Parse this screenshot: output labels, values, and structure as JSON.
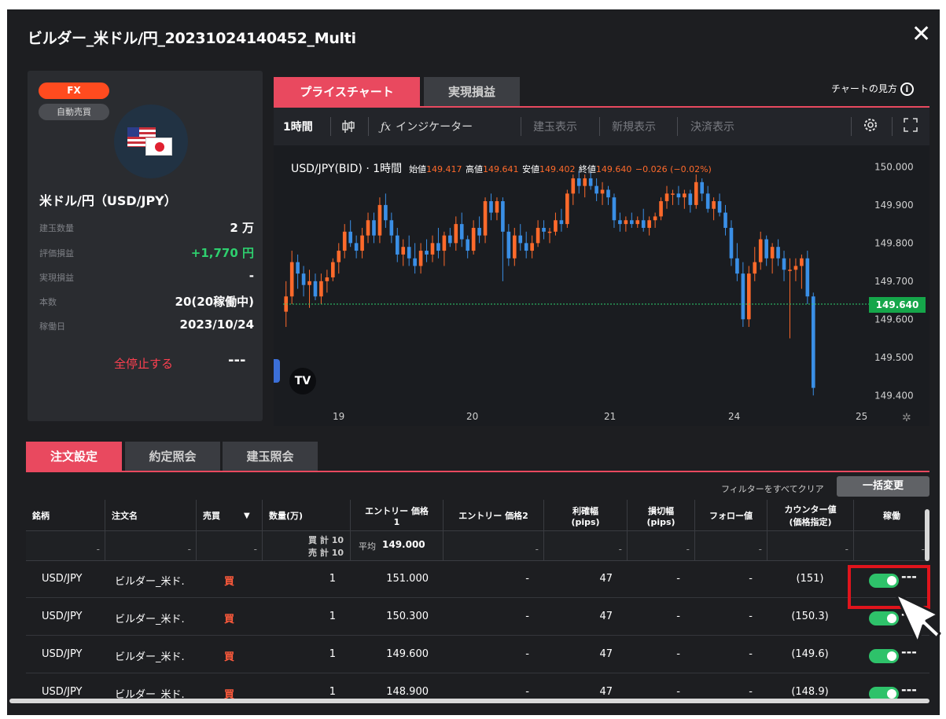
{
  "window": {
    "title": "ビルダー_米ドル/円_20231024140452_Multi",
    "close": "✕"
  },
  "info": {
    "badge_fx": "FX",
    "badge_auto": "自動売買",
    "pair": "米ドル/円（USD/JPY）",
    "rows": [
      {
        "label": "建玉数量",
        "value": "2 万"
      },
      {
        "label": "評価損益",
        "value": "+1,770 円"
      },
      {
        "label": "実現損益",
        "value": "-"
      },
      {
        "label": "本数",
        "value": "20(20稼働中)"
      },
      {
        "label": "稼働日",
        "value": "2023/10/24"
      }
    ],
    "stop_all": "全停止する",
    "more": "---"
  },
  "chart_panel": {
    "tabs": [
      "プライスチャート",
      "実現損益"
    ],
    "help": "チャートの見方",
    "toolbar": {
      "interval": "1時間",
      "indicator": "インジケーター",
      "show_positions": "建玉表示",
      "show_new": "新規表示",
      "show_settled": "決済表示"
    }
  },
  "chart_data": {
    "type": "candlestick",
    "symbol": "USD/JPY(BID) · 1時間",
    "ohlc_text": {
      "open_label": "始値",
      "open": "149.417",
      "high_label": "高値",
      "high": "149.641",
      "low_label": "安値",
      "low": "149.402",
      "close_label": "終値",
      "close": "149.640",
      "change": "−0.026 (−0.02%)"
    },
    "y_ticks": [
      "150.000",
      "149.900",
      "149.800",
      "149.700",
      "149.600",
      "149.500",
      "149.400"
    ],
    "y_range": [
      149.38,
      150.04
    ],
    "x_ticks": [
      "19",
      "20",
      "21",
      "24",
      "25"
    ],
    "last_price": "149.640",
    "candles": [
      [
        149.62,
        149.7,
        149.58,
        149.66
      ],
      [
        149.66,
        149.78,
        149.64,
        149.75
      ],
      [
        149.75,
        149.77,
        149.68,
        149.72
      ],
      [
        149.72,
        149.74,
        149.66,
        149.69
      ],
      [
        149.69,
        149.73,
        149.63,
        149.7
      ],
      [
        149.7,
        149.72,
        149.65,
        149.66
      ],
      [
        149.66,
        149.72,
        149.64,
        149.7
      ],
      [
        149.7,
        149.73,
        149.67,
        149.71
      ],
      [
        149.71,
        149.76,
        149.7,
        149.75
      ],
      [
        149.75,
        149.8,
        149.72,
        149.78
      ],
      [
        149.78,
        149.85,
        149.76,
        149.83
      ],
      [
        149.83,
        149.86,
        149.79,
        149.8
      ],
      [
        149.8,
        149.82,
        149.76,
        149.78
      ],
      [
        149.78,
        149.84,
        149.76,
        149.82
      ],
      [
        149.82,
        149.88,
        149.8,
        149.86
      ],
      [
        149.86,
        149.88,
        149.8,
        149.82
      ],
      [
        149.82,
        149.92,
        149.8,
        149.9
      ],
      [
        149.9,
        149.93,
        149.84,
        149.86
      ],
      [
        149.86,
        149.88,
        149.8,
        149.82
      ],
      [
        149.82,
        149.84,
        149.75,
        149.77
      ],
      [
        149.77,
        149.81,
        149.74,
        149.79
      ],
      [
        149.79,
        149.82,
        149.74,
        149.76
      ],
      [
        149.76,
        149.8,
        149.72,
        149.74
      ],
      [
        149.74,
        149.8,
        149.72,
        149.78
      ],
      [
        149.78,
        149.81,
        149.75,
        149.77
      ],
      [
        149.77,
        149.82,
        149.75,
        149.8
      ],
      [
        149.8,
        149.84,
        149.76,
        149.78
      ],
      [
        149.78,
        149.83,
        149.74,
        149.82
      ],
      [
        149.82,
        149.84,
        149.79,
        149.8
      ],
      [
        149.8,
        149.87,
        149.78,
        149.85
      ],
      [
        149.85,
        149.88,
        149.79,
        149.81
      ],
      [
        149.81,
        149.82,
        149.76,
        149.78
      ],
      [
        149.78,
        149.86,
        149.77,
        149.84
      ],
      [
        149.84,
        149.87,
        149.8,
        149.82
      ],
      [
        149.82,
        149.92,
        149.8,
        149.91
      ],
      [
        149.91,
        149.93,
        149.86,
        149.88
      ],
      [
        149.88,
        149.92,
        149.86,
        149.91
      ],
      [
        149.91,
        149.92,
        149.7,
        149.83
      ],
      [
        149.83,
        149.85,
        149.74,
        149.76
      ],
      [
        149.76,
        149.84,
        149.74,
        149.82
      ],
      [
        149.82,
        149.85,
        149.78,
        149.8
      ],
      [
        149.8,
        149.83,
        149.76,
        149.78
      ],
      [
        149.78,
        149.82,
        149.76,
        149.8
      ],
      [
        149.8,
        149.86,
        149.79,
        149.84
      ],
      [
        149.84,
        149.86,
        149.81,
        149.83
      ],
      [
        149.83,
        149.84,
        149.8,
        149.83
      ],
      [
        149.83,
        149.88,
        149.82,
        149.86
      ],
      [
        149.86,
        149.89,
        149.83,
        149.85
      ],
      [
        149.85,
        149.94,
        149.84,
        149.93
      ],
      [
        149.93,
        149.98,
        149.9,
        149.97
      ],
      [
        149.97,
        149.99,
        149.93,
        149.95
      ],
      [
        149.95,
        149.98,
        149.92,
        149.97
      ],
      [
        149.97,
        149.99,
        149.94,
        149.95
      ],
      [
        149.95,
        149.97,
        149.91,
        149.93
      ],
      [
        149.93,
        149.96,
        149.9,
        149.94
      ],
      [
        149.94,
        149.95,
        149.9,
        149.92
      ],
      [
        149.92,
        149.93,
        149.84,
        149.86
      ],
      [
        149.86,
        149.88,
        149.83,
        149.85
      ],
      [
        149.85,
        149.87,
        149.83,
        149.86
      ],
      [
        149.86,
        149.88,
        149.84,
        149.85
      ],
      [
        149.85,
        149.87,
        149.84,
        149.86
      ],
      [
        149.86,
        149.89,
        149.83,
        149.84
      ],
      [
        149.84,
        149.87,
        149.82,
        149.86
      ],
      [
        149.86,
        149.88,
        149.84,
        149.87
      ],
      [
        149.87,
        149.92,
        149.86,
        149.91
      ],
      [
        149.91,
        149.95,
        149.89,
        149.93
      ],
      [
        149.93,
        149.94,
        149.9,
        149.93
      ],
      [
        149.93,
        149.95,
        149.9,
        149.92
      ],
      [
        149.92,
        149.94,
        149.89,
        149.93
      ],
      [
        149.93,
        149.94,
        149.88,
        149.9
      ],
      [
        149.9,
        149.98,
        149.89,
        149.96
      ],
      [
        149.96,
        149.97,
        149.91,
        149.93
      ],
      [
        149.93,
        149.95,
        149.88,
        149.89
      ],
      [
        149.89,
        149.92,
        149.86,
        149.91
      ],
      [
        149.91,
        149.93,
        149.87,
        149.88
      ],
      [
        149.88,
        149.9,
        149.82,
        149.84
      ],
      [
        149.84,
        149.86,
        149.74,
        149.76
      ],
      [
        149.76,
        149.8,
        149.7,
        149.72
      ],
      [
        149.72,
        149.75,
        149.58,
        149.6
      ],
      [
        149.6,
        149.74,
        149.58,
        149.72
      ],
      [
        149.72,
        149.79,
        149.7,
        149.75
      ],
      [
        149.75,
        149.83,
        149.73,
        149.81
      ],
      [
        149.81,
        149.82,
        149.74,
        149.76
      ],
      [
        149.76,
        149.8,
        149.72,
        149.79
      ],
      [
        149.79,
        149.81,
        149.74,
        149.76
      ],
      [
        149.76,
        149.78,
        149.7,
        149.73
      ],
      [
        149.73,
        149.76,
        149.55,
        149.73
      ],
      [
        149.73,
        149.76,
        149.7,
        149.74
      ],
      [
        149.74,
        149.77,
        149.68,
        149.76
      ],
      [
        149.76,
        149.78,
        149.64,
        149.66
      ],
      [
        149.66,
        149.67,
        149.4,
        149.42
      ]
    ]
  },
  "orders": {
    "tabs": [
      "注文設定",
      "約定照会",
      "建玉照会"
    ],
    "filter_clear": "フィルターをすべてクリア",
    "bulk_change": "一括変更",
    "columns": [
      "銘柄",
      "注文名",
      "売買",
      "数量(万)",
      "エントリー 価格\n1",
      "エントリー 価格2",
      "利確幅\n(pips)",
      "損切幅\n(pips)",
      "フォロー値",
      "カウンター値\n(価格指定)",
      "稼働"
    ],
    "filter_row": {
      "qty_buy": "買 計 10",
      "qty_sell": "売 計 10",
      "entry_avg_label": "平均",
      "entry_avg": "149.000",
      "dash": "-"
    },
    "rows": [
      {
        "symbol": "USD/JPY",
        "name": "ビルダー_米ド.",
        "side": "買",
        "qty": "1",
        "entry1": "151.000",
        "entry2": "-",
        "take_profit": "47",
        "stop_loss": "-",
        "follow": "-",
        "counter": "(151)",
        "more": "---"
      },
      {
        "symbol": "USD/JPY",
        "name": "ビルダー_米ド.",
        "side": "買",
        "qty": "1",
        "entry1": "150.300",
        "entry2": "-",
        "take_profit": "47",
        "stop_loss": "-",
        "follow": "-",
        "counter": "(150.3)",
        "more": "---"
      },
      {
        "symbol": "USD/JPY",
        "name": "ビルダー_米ド.",
        "side": "買",
        "qty": "1",
        "entry1": "149.600",
        "entry2": "-",
        "take_profit": "47",
        "stop_loss": "-",
        "follow": "-",
        "counter": "(149.6)",
        "more": "---"
      },
      {
        "symbol": "USD/JPY",
        "name": "ビルダー_米ド.",
        "side": "買",
        "qty": "1",
        "entry1": "148.900",
        "entry2": "-",
        "take_profit": "47",
        "stop_loss": "-",
        "follow": "-",
        "counter": "(148.9)",
        "more": "---"
      }
    ]
  },
  "colors": {
    "accent": "#e9495f",
    "up": "#ff6a2b",
    "down": "#3a8fe6",
    "toggle_on": "#2ec26a",
    "highlight": "#e0141c"
  }
}
